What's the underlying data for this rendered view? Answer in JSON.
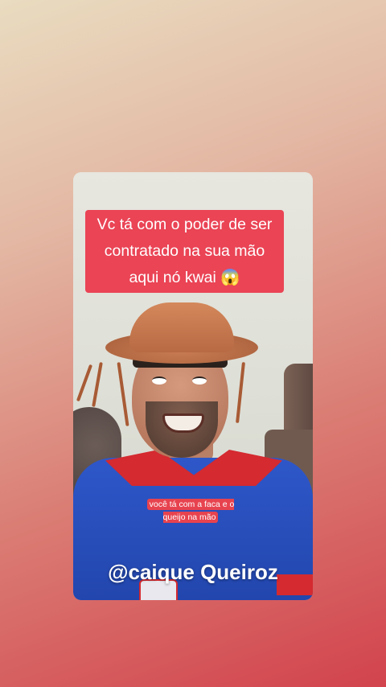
{
  "overlay": {
    "headline": "Vc tá com o poder de ser contratado na sua mão aqui nó kwai 😱",
    "caption": "você tá com a faca e o queijo na mão",
    "handle": "@caique Queiroz"
  },
  "colors": {
    "headline_bg": "#ea4455",
    "caption_bg": "#e7434f",
    "text": "#ffffff"
  }
}
